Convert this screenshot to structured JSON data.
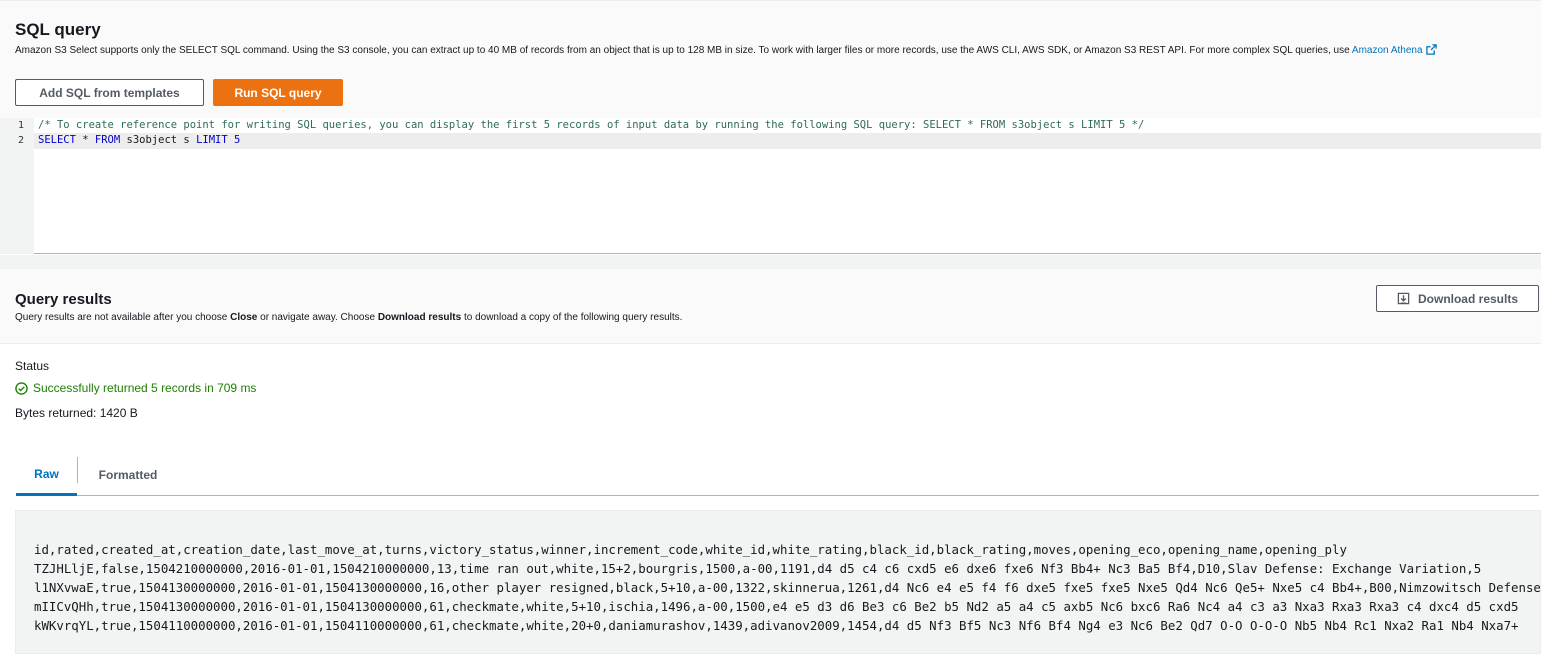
{
  "sql": {
    "title": "SQL query",
    "description": "Amazon S3 Select supports only the SELECT SQL command. Using the S3 console, you can extract up to 40 MB of records from an object that is up to 128 MB in size. To work with larger files or more records, use the AWS CLI, AWS SDK, or Amazon S3 REST API. For more complex SQL queries, use ",
    "athena_link": "Amazon Athena",
    "add_templates_label": "Add SQL from templates",
    "run_label": "Run SQL query",
    "accent_color": "#ec7211"
  },
  "editor": {
    "line_numbers": [
      "1",
      "2"
    ],
    "comment_line": "/* To create reference point for writing SQL queries, you can display the first 5 records of input data by running the following SQL query: SELECT * FROM s3object s LIMIT 5 */",
    "query": {
      "select": "SELECT",
      "star": " * ",
      "from": "FROM",
      "table": " s3object s ",
      "limit": "LIMIT",
      "limit_value": " 5"
    }
  },
  "results": {
    "title": "Query results",
    "desc_1": "Query results are not available after you choose ",
    "desc_close": "Close",
    "desc_2": " or navigate away. Choose ",
    "desc_download": "Download results",
    "desc_3": " to download a copy of the following query results.",
    "download_label": "Download results",
    "status_label": "Status",
    "status_text": "Successfully returned 5 records in 709 ms",
    "bytes_text": "Bytes returned: 1420 B",
    "success_color": "#1d8102",
    "tabs": [
      {
        "label": "Raw",
        "active": true
      },
      {
        "label": "Formatted",
        "active": false
      }
    ],
    "raw_lines": [
      "id,rated,created_at,creation_date,last_move_at,turns,victory_status,winner,increment_code,white_id,white_rating,black_id,black_rating,moves,opening_eco,opening_name,opening_ply",
      "TZJHLljE,false,1504210000000,2016-01-01,1504210000000,13,time ran out,white,15+2,bourgris,1500,a-00,1191,d4 d5 c4 c6 cxd5 e6 dxe6 fxe6 Nf3 Bb4+ Nc3 Ba5 Bf4,D10,Slav Defense: Exchange Variation,5",
      "l1NXvwaE,true,1504130000000,2016-01-01,1504130000000,16,other player resigned,black,5+10,a-00,1322,skinnerua,1261,d4 Nc6 e4 e5 f4 f6 dxe5 fxe5 fxe5 Nxe5 Qd4 Nc6 Qe5+ Nxe5 c4 Bb4+,B00,Nimzowitsch Defense",
      "mIICvQHh,true,1504130000000,2016-01-01,1504130000000,61,checkmate,white,5+10,ischia,1496,a-00,1500,e4 e5 d3 d6 Be3 c6 Be2 b5 Nd2 a5 a4 c5 axb5 Nc6 bxc6 Ra6 Nc4 a4 c3 a3 Nxa3 Rxa3 Rxa3 c4 dxc4 d5 cxd5",
      "kWKvrqYL,true,1504110000000,2016-01-01,1504110000000,61,checkmate,white,20+0,daniamurashov,1439,adivanov2009,1454,d4 d5 Nf3 Bf5 Nc3 Nf6 Bf4 Ng4 e3 Nc6 Be2 Qd7 O-O O-O-O Nb5 Nb4 Rc1 Nxa2 Ra1 Nb4 Nxa7+"
    ]
  }
}
